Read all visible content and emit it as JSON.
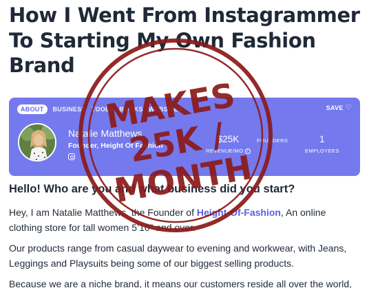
{
  "article": {
    "title": "How I Went From Instagrammer To Starting My Own Fashion Brand"
  },
  "card": {
    "tabs": [
      {
        "label": "ABOUT",
        "active": true
      },
      {
        "label": "BUSINESS",
        "active": false
      },
      {
        "label": "TOOLS",
        "active": false
      },
      {
        "label": "BOOKS",
        "active": false
      },
      {
        "label": "WEBSITES",
        "active": false
      }
    ],
    "save_label": "SAVE",
    "heart_icon": "heart-outline-icon",
    "founder": {
      "name": "Natalie Matthews",
      "role": "Founder, Height Of Fashion",
      "social_icon": "instagram-icon"
    },
    "stats": [
      {
        "value": "$25K",
        "label": "REVENUE/MO"
      },
      {
        "value": "",
        "label": "FOUNDERS"
      },
      {
        "value": "1",
        "label": "EMPLOYEES"
      }
    ],
    "color": "#7479ed"
  },
  "stamp": {
    "line1": "MAKES",
    "line2": "25K /",
    "line3": "MONTH",
    "color": "#8b1a1a"
  },
  "content": {
    "question": "Hello! Who are you and what business did you start?",
    "p1_prefix": "Hey, I am Natalie Matthews, the Founder of ",
    "p1_link": "Height-Of-Fashion",
    "p1_suffix": ", An online clothing store for tall women 5’10” and over.",
    "p2": "Our products range from casual daywear to evening and workwear, with Jeans, Leggings and Playsuits being some of our biggest selling products.",
    "p3": "Because we are a niche brand, it means our customers reside all over the world,"
  }
}
